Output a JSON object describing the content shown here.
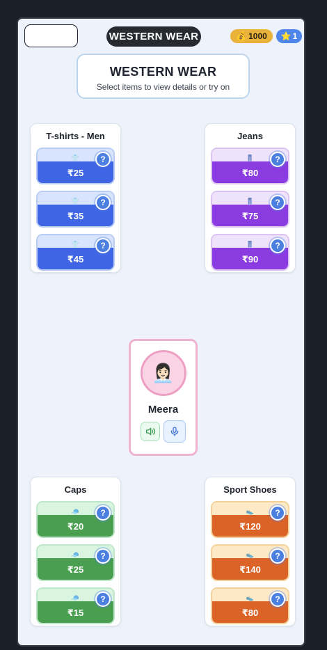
{
  "header": {
    "title": "WESTERN WEAR",
    "coins": "1000",
    "stars": "1",
    "coin_icon": "💰",
    "star_icon": "⭐"
  },
  "intro": {
    "title": "WESTERN WEAR",
    "subtitle": "Select items to view details or try on"
  },
  "categories": [
    {
      "name": "T-shirts - Men",
      "color": "blue",
      "items": [
        {
          "price": "₹25"
        },
        {
          "price": "₹35"
        },
        {
          "price": "₹45"
        }
      ]
    },
    {
      "name": "Jeans",
      "color": "purple",
      "items": [
        {
          "price": "₹80"
        },
        {
          "price": "₹75"
        },
        {
          "price": "₹90"
        }
      ]
    },
    {
      "name": "Caps",
      "color": "green",
      "items": [
        {
          "price": "₹20"
        },
        {
          "price": "₹25"
        },
        {
          "price": "₹15"
        }
      ]
    },
    {
      "name": "Sport Shoes",
      "color": "orange",
      "items": [
        {
          "price": "₹120"
        },
        {
          "price": "₹140"
        },
        {
          "price": "₹80"
        }
      ]
    }
  ],
  "assistant": {
    "name": "Meera",
    "avatar": "👩🏻‍💼"
  },
  "icons": {
    "info": "?"
  }
}
